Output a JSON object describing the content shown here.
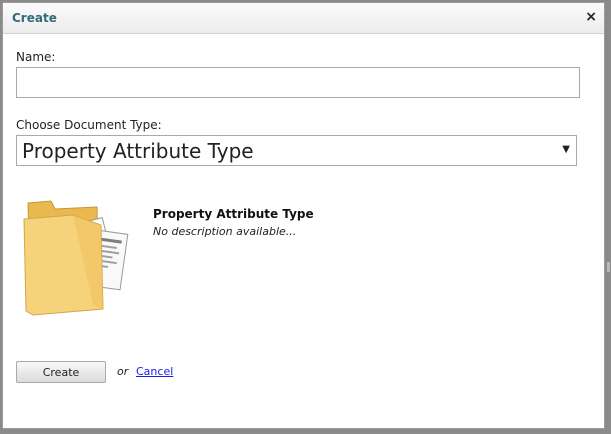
{
  "dialog": {
    "title": "Create",
    "close_symbol": "×",
    "close_icon": "close-icon"
  },
  "form": {
    "name_label": "Name:",
    "name_value": "",
    "doctype_label": "Choose Document Type:",
    "doctype_selected": "Property Attribute Type",
    "dropdown_icon": "chevron-down-icon",
    "dropdown_arrow": "▼"
  },
  "preview": {
    "icon": "folder-documents-icon",
    "title": "Property Attribute Type",
    "description": "No description available..."
  },
  "actions": {
    "create_label": "Create",
    "or_text": "or",
    "cancel_label": "Cancel"
  },
  "colors": {
    "title_text": "#2f6b7a",
    "link": "#1a1aee",
    "folder": "#f6d27a"
  }
}
